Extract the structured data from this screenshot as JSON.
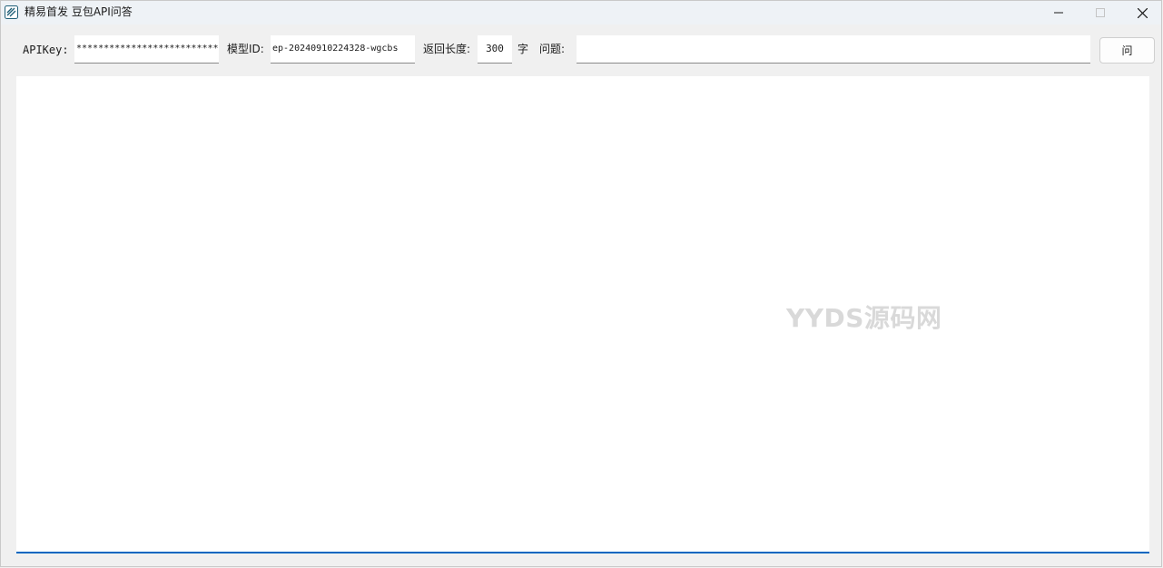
{
  "window": {
    "title": "精易首发 豆包API问答"
  },
  "toolbar": {
    "apikey_label": "APIKey:",
    "apikey_value": "**************************",
    "model_label": "模型ID:",
    "model_value": "ep-20240910224328-wgcbs",
    "length_label": "返回长度:",
    "length_value": "300",
    "length_unit": "字",
    "question_label": "问题:",
    "question_value": "",
    "ask_button": "问"
  },
  "output": {
    "content": ""
  },
  "watermark": "YYDS源码网",
  "colors": {
    "accent": "#0067c0",
    "titlebar": "#eef2f6",
    "background": "#f0f0f0"
  },
  "icons": {
    "app": "app-logo-icon",
    "minimize": "minimize-icon",
    "maximize": "maximize-icon",
    "close": "close-icon"
  }
}
